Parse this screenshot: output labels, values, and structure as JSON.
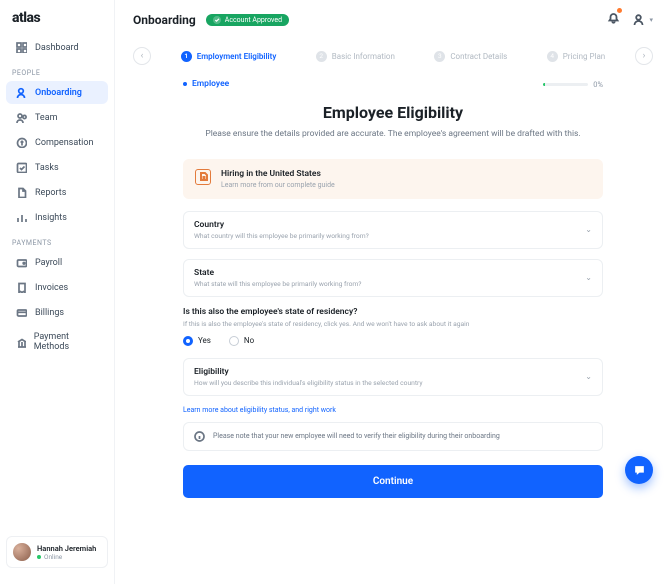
{
  "brand": "atlas",
  "header": {
    "title": "Onboarding",
    "badge": "Account Approved"
  },
  "nav": {
    "dashboard": "Dashboard",
    "sections": {
      "people": "PEOPLE",
      "payments": "PAYMENTS"
    },
    "items": {
      "onboarding": "Onboarding",
      "team": "Team",
      "compensation": "Compensation",
      "tasks": "Tasks",
      "reports": "Reports",
      "insights": "Insights",
      "payroll": "Payroll",
      "invoices": "Invoices",
      "billings": "Billings",
      "payment_methods": "Payment Methods"
    }
  },
  "user": {
    "name": "Hannah Jeremiah",
    "status": "Online"
  },
  "stepper": {
    "s1": "Employment Eligibility",
    "s2": "Basic Information",
    "s3": "Contract Details",
    "s4": "Pricing Plan"
  },
  "tabs": {
    "employee": "Employee",
    "progress": "0%"
  },
  "page": {
    "heading": "Employee Eligibility",
    "sub": "Please ensure the details provided are accurate. The employee's agreement will be drafted with this."
  },
  "notice": {
    "title": "Hiring in the United States",
    "sub": "Learn more from our complete guide"
  },
  "fields": {
    "country": {
      "label": "Country",
      "hint": "What country will this employee be primarily working from?"
    },
    "state": {
      "label": "State",
      "hint": "What state will this employee be primarily working from?"
    },
    "eligibility": {
      "label": "Eligibility",
      "hint": "How will you describe this individual's eligibility status in the selected country"
    }
  },
  "residency": {
    "question": "Is this also the employee's state of residency?",
    "hint": "If this is also the employee's state of residency, click yes. And we won't have to ask about it again",
    "yes": "Yes",
    "no": "No"
  },
  "link": "Learn more about eligibility status, and right work",
  "info": "Please note that your new employee will need to verify their eligibility during their onboarding",
  "cta": "Continue"
}
